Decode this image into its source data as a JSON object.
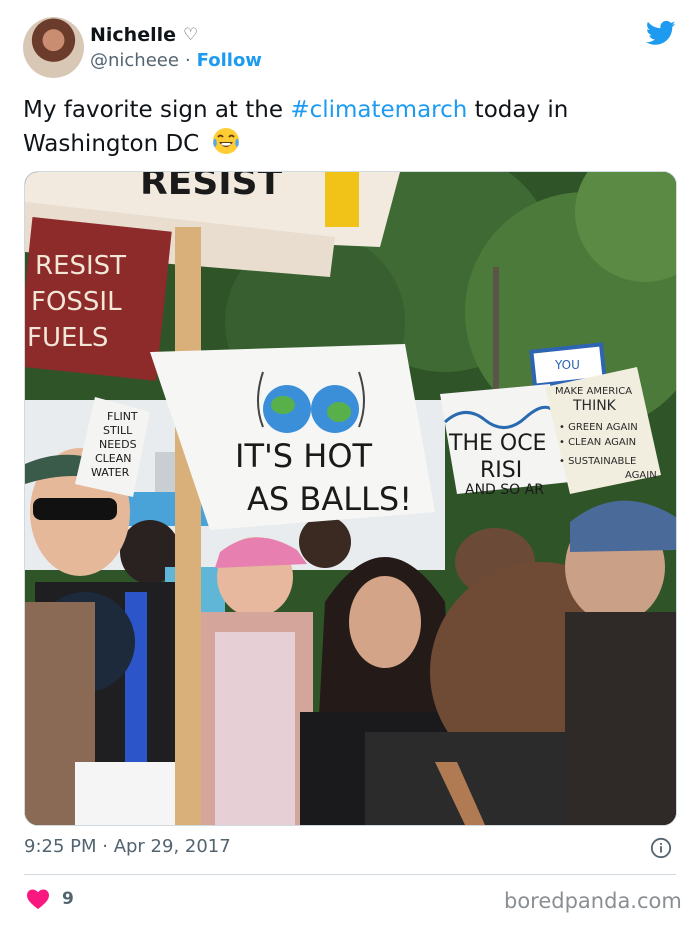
{
  "tweet": {
    "display_name": "Nichelle",
    "name_symbol": "♡",
    "handle": "@nicheee",
    "separator": "·",
    "follow_label": "Follow",
    "text_before": "My favorite sign at the ",
    "hashtag": "#climatemarch",
    "text_after": " today in Washington DC",
    "emoji_icon": "tears-of-joy-emoji-icon",
    "timestamp": "9:25 PM · Apr 29, 2017",
    "like_count": "9"
  },
  "photo": {
    "signs": {
      "top_banner": "RESIST",
      "left_sign": [
        "RESIST",
        "FOSSIL",
        "FUELS"
      ],
      "small_sign": [
        "FLINT",
        "STILL",
        "NEEDS",
        "CLEAN",
        "WATER"
      ],
      "main_sign": [
        "IT'S HOT",
        "AS BALLS!"
      ],
      "ocean_sign": [
        "THE OCE",
        "RISI",
        "AND SO AR"
      ],
      "america_sign": [
        "MAKE AMERICA",
        "THINK",
        "• GREEN AGAIN",
        "• CLEAN AGAIN",
        "• SUSTAINABLE",
        "AGAIN"
      ],
      "blue_sign": "YOU"
    }
  },
  "footer": {
    "watermark": "boredpanda.com"
  },
  "colors": {
    "accent": "#1d9bf0",
    "like": "#f91880",
    "text_secondary": "#536471"
  },
  "icons": [
    "twitter-bird-icon",
    "info-icon",
    "heart-icon",
    "tears-of-joy-emoji-icon"
  ]
}
